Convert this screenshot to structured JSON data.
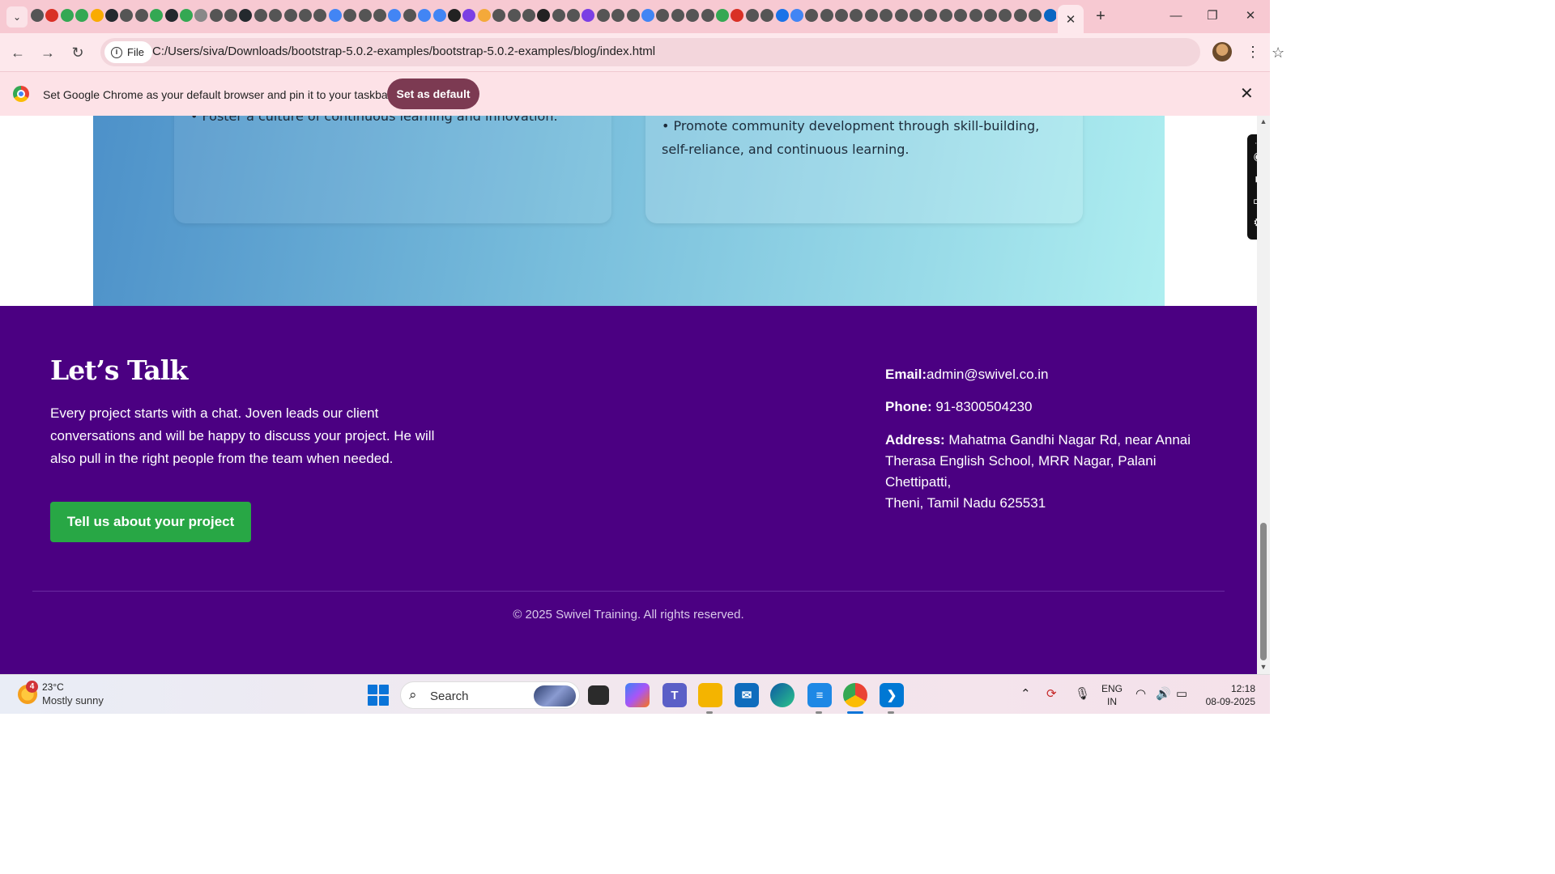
{
  "browser": {
    "tab_strip": {
      "tab_search_icon": "chevron-down-icon",
      "favicon_colors": [
        "#555",
        "#d93025",
        "#34a853",
        "#34a853",
        "#f9ab00",
        "#24292e",
        "#555",
        "#555",
        "#34a853",
        "#24292e",
        "#34a853",
        "#888",
        "#555",
        "#555",
        "#24292e",
        "#555",
        "#555",
        "#555",
        "#555",
        "#555",
        "#4285f4",
        "#555",
        "#555",
        "#555",
        "#4285f4",
        "#555",
        "#4285f4",
        "#4285f4",
        "#222",
        "#7b3fe4",
        "#f4a93a",
        "#555",
        "#555",
        "#555",
        "#222",
        "#555",
        "#555",
        "#7b3fe4",
        "#555",
        "#555",
        "#555",
        "#4285f4",
        "#555",
        "#555",
        "#555",
        "#555",
        "#34a853",
        "#d93025",
        "#555",
        "#555",
        "#1a73e8",
        "#4285f4",
        "#555",
        "#555",
        "#555",
        "#555",
        "#555",
        "#555",
        "#555",
        "#555",
        "#555",
        "#555",
        "#555",
        "#555",
        "#555",
        "#555",
        "#555",
        "#555",
        "#0a66c2"
      ],
      "active_tab_close": "✕",
      "new_tab_label": "+"
    },
    "window_controls": {
      "minimize": "—",
      "restore": "❐",
      "close": "✕"
    },
    "address_bar": {
      "file_chip_label": "File",
      "url": "C:/Users/siva/Downloads/bootstrap-5.0.2-examples/bootstrap-5.0.2-examples/blog/index.html"
    },
    "infobar": {
      "message": "Set Google Chrome as your default browser and pin it to your taskbar",
      "button_label": "Set as default",
      "close_label": "✕"
    }
  },
  "page": {
    "cards": {
      "left_text": "• Foster a culture of continuous learning and innovation.",
      "right_text": "• Promote community development through skill-building, self-reliance, and continuous learning."
    },
    "footer": {
      "heading": "Let’s Talk",
      "lead": "Every project starts with a chat. Joven leads our client conversations and will be happy to discuss your project. He will also pull in the right people from the team when needed.",
      "cta_label": "Tell us about your project",
      "email_label": "Email:",
      "email_value": "admin@swivel.co.in",
      "phone_label": "Phone:",
      "phone_value": " 91-8300504230",
      "address_label": "Address:",
      "address_line1": " Mahatma Gandhi Nagar Rd, near Annai Therasa English School, MRR Nagar, Palani Chettipatti,",
      "address_line2": "Theni, Tamil Nadu 625531",
      "copyright": "© 2025 Swivel Training. All rights reserved.",
      "colors": {
        "background": "#4b0082",
        "cta": "#28a745"
      }
    }
  },
  "taskbar": {
    "weather": {
      "badge": "4",
      "temperature": "23°C",
      "condition": "Mostly sunny"
    },
    "search_placeholder": "Search",
    "language_line1": "ENG",
    "language_line2": "IN",
    "time": "12:18",
    "date": "08-09-2025"
  }
}
